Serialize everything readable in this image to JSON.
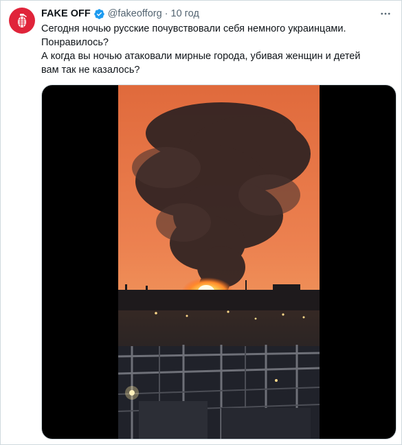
{
  "tweet": {
    "author": {
      "name": "FAKE OFF",
      "handle": "@fakeofforg",
      "avatar_icon": "grenade-icon",
      "verified_icon": "verified-badge-icon",
      "avatar_color": "#e0243a",
      "verified_color": "#1d9bf0"
    },
    "separator": "·",
    "timestamp": "10 год",
    "more_icon": "more-options-icon",
    "text_lines": [
      "Сегодня ночью русские почувствовали себя немного украинцами.",
      "Понравилось?",
      "А когда вы ночью атаковали мирные города, убивая женщин и детей",
      "вам так не казалось?"
    ],
    "media": {
      "type": "video"
    }
  }
}
